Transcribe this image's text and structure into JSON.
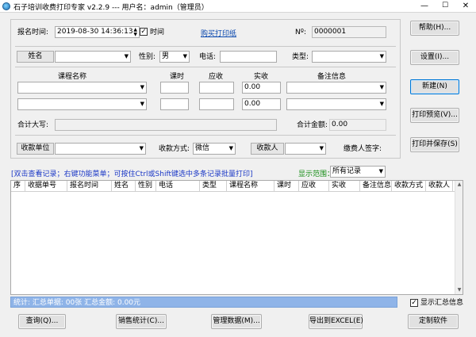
{
  "window": {
    "title": "石子培训收费打印专家 v2.2.9 --- 用户名：admin（管理员）",
    "minimize": "—",
    "maximize": "☐",
    "close": "✕"
  },
  "form": {
    "signup_time_label": "报名时间:",
    "signup_time_value": "2019-08-30 14:36:13",
    "time_checkbox_label": "时间",
    "time_checked": "✓",
    "buy_paper_link": "购买打印纸",
    "no_label": "Nº:",
    "no_value": "0000001",
    "name_button": "姓名",
    "name_value": "",
    "gender_label": "性别:",
    "gender_value": "男",
    "phone_label": "电话:",
    "phone_value": "",
    "type_label": "类型:",
    "type_value": "",
    "course_header": "课程名称",
    "hours_header": "课时",
    "due_header": "应收",
    "paid_header": "实收",
    "remark_header": "备注信息",
    "rows": [
      {
        "course": "",
        "hours": "",
        "due": "",
        "paid": "0.00",
        "remark": ""
      },
      {
        "course": "",
        "hours": "",
        "due": "",
        "paid": "0.00",
        "remark": ""
      }
    ],
    "total_caps_label": "合计大写:",
    "total_caps_value": "",
    "total_amount_label": "合计金额:",
    "total_amount_value": "0.00",
    "unit_button": "收款单位",
    "unit_value": "",
    "pay_method_label": "收款方式:",
    "pay_method_value": "微信",
    "payee_button": "收款人",
    "payee_value": "",
    "payer_sign_label": "缴费人签字:"
  },
  "side_buttons": {
    "help": "帮助(H)...",
    "settings": "设置(I)...",
    "new": "新建(N)",
    "preview": "打印预览(V)...",
    "print_save": "打印并保存(S)"
  },
  "hint_text": "[双击查看记录；右键功能菜单；可按住Ctrl或Shift键选中多条记录批量打印]",
  "display_range_label": "显示范围：",
  "display_range_value": "所有记录",
  "grid": {
    "columns": [
      "序",
      "收据单号",
      "报名时间",
      "姓名",
      "性别",
      "电话",
      "类型",
      "课程名称",
      "课时",
      "应收",
      "实收",
      "备注信息",
      "收款方式",
      "收款人",
      "收"
    ],
    "scroll_up": "▲",
    "scroll_down": "▼"
  },
  "status": {
    "text": "统计:   汇总单据: 00张     汇总金额: 0.00元",
    "show_summary_label": "显示汇总信息",
    "show_summary_checked": "✓"
  },
  "bottom_buttons": {
    "query": "查询(Q)...",
    "sales_stats": "销售统计(C)...",
    "manage_data": "管理数据(M)...",
    "export_excel": "导出到EXCEL(E)",
    "custom_software": "定制软件"
  },
  "icons": {
    "dropdown": "▼",
    "app": "app-globe-icon"
  }
}
